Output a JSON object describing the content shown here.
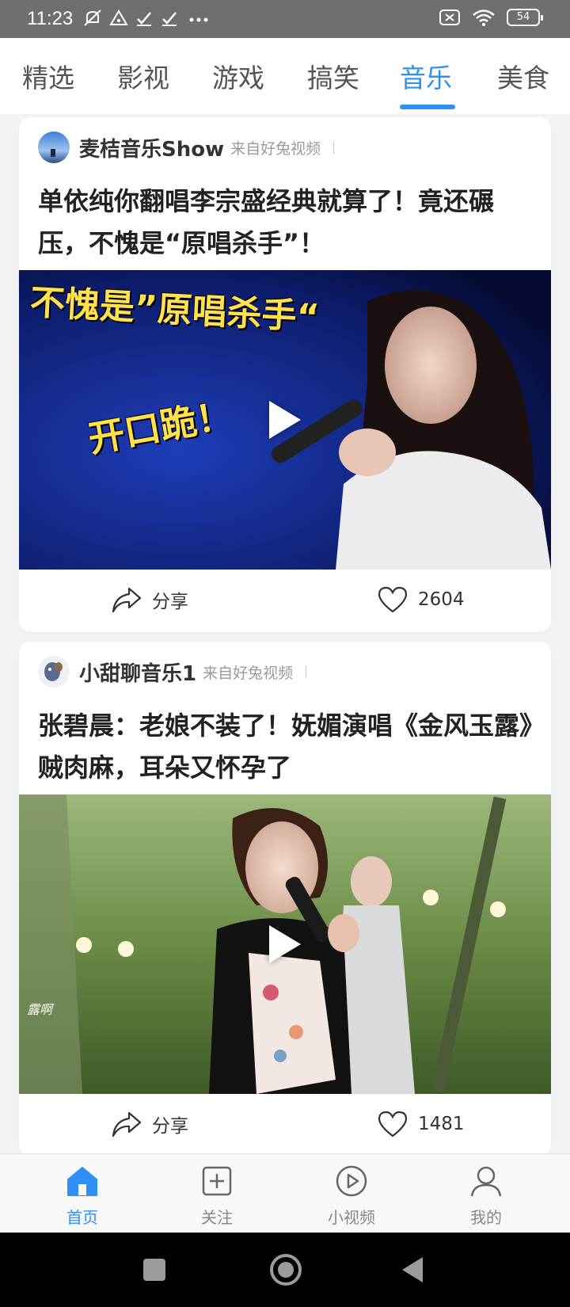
{
  "status_bar": {
    "time": "11:23",
    "battery": "54",
    "icons_left": [
      "mute-icon",
      "warning-icon",
      "check-icon",
      "check-icon",
      "more-dots-icon"
    ],
    "icons_right": [
      "close-box-icon",
      "wifi-icon",
      "battery-icon"
    ]
  },
  "tabs": [
    {
      "label": "精选",
      "active": false
    },
    {
      "label": "影视",
      "active": false
    },
    {
      "label": "游戏",
      "active": false
    },
    {
      "label": "搞笑",
      "active": false
    },
    {
      "label": "音乐",
      "active": true
    },
    {
      "label": "美食",
      "active": false
    }
  ],
  "feed": [
    {
      "author": "麦桔音乐Show",
      "source": "来自好兔视频",
      "title": "单依纯你翻唱李宗盛经典就算了！竟还碾压，不愧是“原唱杀手”！",
      "thumb_caption_top": "不愧是”原唱杀手“",
      "thumb_caption_bottom": "开口跪！",
      "share_label": "分享",
      "like_count": "2604"
    },
    {
      "author": "小甜聊音乐1",
      "source": "来自好兔视频",
      "title": "张碧晨：老娘不装了！妩媚演唱《金风玉露》贼肉麻，耳朵又怀孕了",
      "thumb_watermark": "露啊",
      "share_label": "分享",
      "like_count": "1481"
    }
  ],
  "bottom_nav": [
    {
      "label": "首页",
      "icon": "home-icon",
      "active": true
    },
    {
      "label": "关注",
      "icon": "add-box-icon",
      "active": false
    },
    {
      "label": "小视频",
      "icon": "play-circle-icon",
      "active": false
    },
    {
      "label": "我的",
      "icon": "user-icon",
      "active": false
    }
  ],
  "colors": {
    "accent": "#2e8ff5",
    "status_bar": "#6f6f6f",
    "background": "#f2f3f5"
  }
}
